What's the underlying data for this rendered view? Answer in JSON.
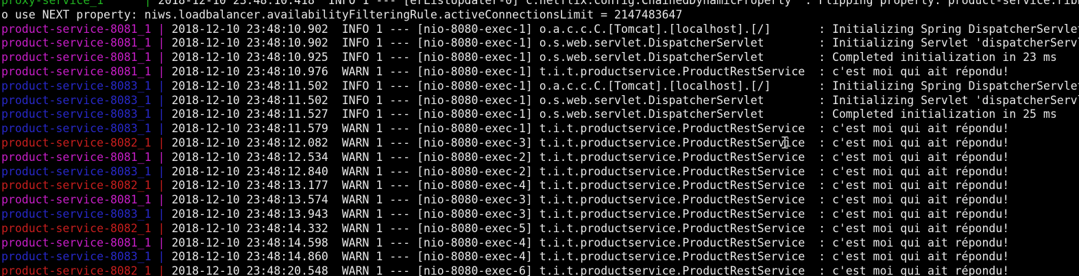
{
  "terminal": {
    "lines": [
      {
        "service": "proxy-service_1      ",
        "color": "#21b321",
        "text": "2018-12-10 23:48:10.418  INFO 1 --- [erListUpdater-0] c.netflix.config.ChainedDynamicProperty  : Flipping property: product-service.ribbon.ActiveConnectionsLimit to use NEXT property: niws.loadbalancer.availabilityFilteringRule.activeConnectionsLimit = 2147483647"
      },
      {
        "service": "",
        "color": "#e8e8e8",
        "text": "o use NEXT property: niws.loadbalancer.availabilityFilteringRule.activeConnectionsLimit = 2147483647"
      },
      {
        "service": "product-service-8081_1 ",
        "color": "#c81ec8",
        "text": "2018-12-10 23:48:10.902  INFO 1 --- [nio-8080-exec-1] o.a.c.c.C.[Tomcat].[localhost].[/]       : Initializing Spring DispatcherServlet 'dispatcherServlet'"
      },
      {
        "service": "product-service-8081_1 ",
        "color": "#c81ec8",
        "text": "2018-12-10 23:48:10.902  INFO 1 --- [nio-8080-exec-1] o.s.web.servlet.DispatcherServlet        : Initializing Servlet 'dispatcherServlet'"
      },
      {
        "service": "product-service-8081_1 ",
        "color": "#c81ec8",
        "text": "2018-12-10 23:48:10.925  INFO 1 --- [nio-8080-exec-1] o.s.web.servlet.DispatcherServlet        : Completed initialization in 23 ms"
      },
      {
        "service": "product-service-8081_1 ",
        "color": "#c81ec8",
        "text": "2018-12-10 23:48:10.976  WARN 1 --- [nio-8080-exec-1] t.i.t.productservice.ProductRestService  : c'est moi qui ait répondu!"
      },
      {
        "service": "product-service-8083_1 ",
        "color": "#2828c8",
        "text": "2018-12-10 23:48:11.502  INFO 1 --- [nio-8080-exec-1] o.a.c.c.C.[Tomcat].[localhost].[/]       : Initializing Spring DispatcherServlet 'dispatcherServlet'"
      },
      {
        "service": "product-service-8083_1 ",
        "color": "#2828c8",
        "text": "2018-12-10 23:48:11.502  INFO 1 --- [nio-8080-exec-1] o.s.web.servlet.DispatcherServlet        : Initializing Servlet 'dispatcherServlet'"
      },
      {
        "service": "product-service-8083_1 ",
        "color": "#2828c8",
        "text": "2018-12-10 23:48:11.527  INFO 1 --- [nio-8080-exec-1] o.s.web.servlet.DispatcherServlet        : Completed initialization in 25 ms"
      },
      {
        "service": "product-service-8083_1 ",
        "color": "#2828c8",
        "text": "2018-12-10 23:48:11.579  WARN 1 --- [nio-8080-exec-1] t.i.t.productservice.ProductRestService  : c'est moi qui ait répondu!"
      },
      {
        "service": "product-service-8082_1 ",
        "color": "#c81e1e",
        "text": "2018-12-10 23:48:12.082  WARN 1 --- [nio-8080-exec-3] t.i.t.productservice.ProductRestService  : c'est moi qui ait répondu!"
      },
      {
        "service": "product-service-8081_1 ",
        "color": "#c81ec8",
        "text": "2018-12-10 23:48:12.534  WARN 1 --- [nio-8080-exec-2] t.i.t.productservice.ProductRestService  : c'est moi qui ait répondu!"
      },
      {
        "service": "product-service-8083_1 ",
        "color": "#2828c8",
        "text": "2018-12-10 23:48:12.840  WARN 1 --- [nio-8080-exec-2] t.i.t.productservice.ProductRestService  : c'est moi qui ait répondu!"
      },
      {
        "service": "product-service-8082_1 ",
        "color": "#c81e1e",
        "text": "2018-12-10 23:48:13.177  WARN 1 --- [nio-8080-exec-4] t.i.t.productservice.ProductRestService  : c'est moi qui ait répondu!"
      },
      {
        "service": "product-service-8081_1 ",
        "color": "#c81ec8",
        "text": "2018-12-10 23:48:13.574  WARN 1 --- [nio-8080-exec-3] t.i.t.productservice.ProductRestService  : c'est moi qui ait répondu!"
      },
      {
        "service": "product-service-8083_1 ",
        "color": "#2828c8",
        "text": "2018-12-10 23:48:13.943  WARN 1 --- [nio-8080-exec-3] t.i.t.productservice.ProductRestService  : c'est moi qui ait répondu!"
      },
      {
        "service": "product-service-8082_1 ",
        "color": "#c81e1e",
        "text": "2018-12-10 23:48:14.332  WARN 1 --- [nio-8080-exec-5] t.i.t.productservice.ProductRestService  : c'est moi qui ait répondu!"
      },
      {
        "service": "product-service-8081_1 ",
        "color": "#c81ec8",
        "text": "2018-12-10 23:48:14.598  WARN 1 --- [nio-8080-exec-4] t.i.t.productservice.ProductRestService  : c'est moi qui ait répondu!"
      },
      {
        "service": "product-service-8083_1 ",
        "color": "#2828c8",
        "text": "2018-12-10 23:48:14.860  WARN 1 --- [nio-8080-exec-4] t.i.t.productservice.ProductRestService  : c'est moi qui ait répondu!"
      },
      {
        "service": "product-service-8082_1 ",
        "color": "#c81e1e",
        "text": "2018-12-10 23:48:20.548  WARN 1 --- [nio-8080-exec-6] t.i.t.productservice.ProductRestService  : c'est moi qui ait répondu!"
      }
    ]
  },
  "cursor": {
    "icon": "text-cursor-icon",
    "color": "#d8d8d8"
  }
}
